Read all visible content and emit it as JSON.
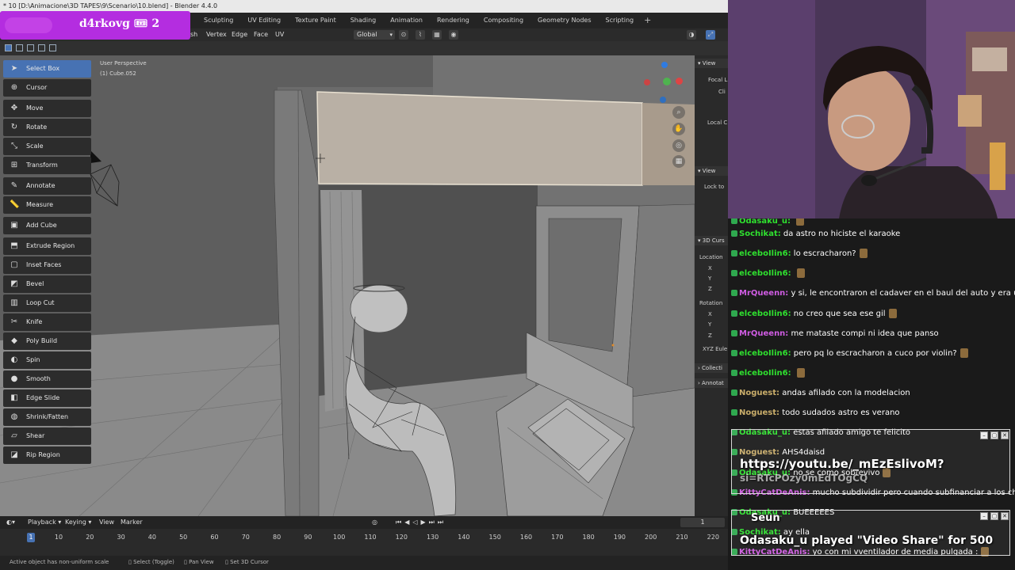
{
  "blender": {
    "title_bar": "* 10 [D:\\Animacione\\3D TAPES\\9\\Scenario\\10.blend] - Blender 4.4.0",
    "workspace_tabs": [
      "Sculpting",
      "UV Editing",
      "Texture Paint",
      "Shading",
      "Animation",
      "Rendering",
      "Compositing",
      "Geometry Nodes",
      "Scripting"
    ],
    "add_tab": "+",
    "edit_menus": [
      "sh",
      "Vertex",
      "Edge",
      "Face",
      "UV"
    ],
    "orientation": "Global",
    "viewport_info": {
      "line1": "User Perspective",
      "line2": "(1) Cube.052"
    },
    "tools": [
      {
        "label": "Select Box",
        "icon": "select-box-icon",
        "glyph": "➤",
        "active": true
      },
      {
        "label": "Cursor",
        "icon": "cursor-icon",
        "glyph": "⊕"
      },
      {
        "label": "Move",
        "icon": "move-icon",
        "glyph": "✥"
      },
      {
        "label": "Rotate",
        "icon": "rotate-icon",
        "glyph": "↻"
      },
      {
        "label": "Scale",
        "icon": "scale-icon",
        "glyph": "⤡"
      },
      {
        "label": "Transform",
        "icon": "transform-icon",
        "glyph": "⊞"
      },
      {
        "label": "Annotate",
        "icon": "annotate-icon",
        "glyph": "✎"
      },
      {
        "label": "Measure",
        "icon": "measure-icon",
        "glyph": "📏"
      },
      {
        "label": "Add Cube",
        "icon": "add-cube-icon",
        "glyph": "▣"
      },
      {
        "label": "Extrude Region",
        "icon": "extrude-region-icon",
        "glyph": "⬒"
      },
      {
        "label": "Inset Faces",
        "icon": "inset-faces-icon",
        "glyph": "▢"
      },
      {
        "label": "Bevel",
        "icon": "bevel-icon",
        "glyph": "◩"
      },
      {
        "label": "Loop Cut",
        "icon": "loop-cut-icon",
        "glyph": "▥"
      },
      {
        "label": "Knife",
        "icon": "knife-icon",
        "glyph": "✂"
      },
      {
        "label": "Poly Build",
        "icon": "poly-build-icon",
        "glyph": "◆"
      },
      {
        "label": "Spin",
        "icon": "spin-icon",
        "glyph": "◐"
      },
      {
        "label": "Smooth",
        "icon": "smooth-icon",
        "glyph": "●"
      },
      {
        "label": "Edge Slide",
        "icon": "edge-slide-icon",
        "glyph": "◧"
      },
      {
        "label": "Shrink/Fatten",
        "icon": "shrink-fatten-icon",
        "glyph": "◍"
      },
      {
        "label": "Shear",
        "icon": "shear-icon",
        "glyph": "▱"
      },
      {
        "label": "Rip Region",
        "icon": "rip-region-icon",
        "glyph": "◪"
      }
    ],
    "npanel": {
      "view": "View",
      "focal": "Focal L",
      "clip": "Cli",
      "local": "Local C",
      "view2": "View",
      "lock": "Lock to",
      "cursor3d": "3D Curs",
      "location": "Location",
      "x": "X",
      "y": "Y",
      "z": "Z",
      "rotation": "Rotation",
      "rx": "X",
      "ry": "Y",
      "rz": "Z",
      "euler": "XYZ Eule",
      "collection": "Collecti",
      "annotations": "Annotat"
    },
    "timeline": {
      "menus": [
        "Playback",
        "Keying",
        "View",
        "Marker"
      ],
      "current_frame_box": "1",
      "current_frame_marker": "1",
      "ticks": [
        "10",
        "20",
        "30",
        "40",
        "50",
        "60",
        "70",
        "80",
        "90",
        "100",
        "110",
        "120",
        "130",
        "140",
        "150",
        "160",
        "170",
        "180",
        "190",
        "200",
        "210",
        "220"
      ]
    },
    "status": {
      "left": "Active object has non-uniform scale",
      "select": "Select (Toggle)",
      "pan": "Pan View",
      "cursor": "Set 3D Cursor"
    }
  },
  "overlay": {
    "channel": "d4rkovg 🎟 2"
  },
  "chat": {
    "messages": [
      {
        "user": "Odasaku_u:",
        "text": "",
        "color": "#2fe02f",
        "emote": true
      },
      {
        "user": "Sochikat:",
        "text": "da astro no hiciste el karaoke",
        "color": "#2fe02f"
      },
      {
        "user": "elceboIlin6:",
        "text": "lo escracharon?",
        "color": "#2fe02f",
        "emote": true
      },
      {
        "user": "elceboIlin6:",
        "text": "",
        "color": "#2fe02f",
        "emote": true
      },
      {
        "user": "MrQueenn:",
        "text": "y si, le encontraron el cadaver en el baul del auto y era una menor",
        "color": "#d05ce3"
      },
      {
        "user": "elceboIlin6:",
        "text": "no creo que sea ese gil",
        "color": "#2fe02f",
        "emote": true
      },
      {
        "user": "MrQueenn:",
        "text": "me mataste compi ni idea que panso",
        "color": "#d05ce3"
      },
      {
        "user": "elceboIlin6:",
        "text": "pero pq lo escracharon a cuco por violin?",
        "color": "#2fe02f",
        "emote": true
      },
      {
        "user": "elceboIlin6:",
        "text": "",
        "color": "#2fe02f",
        "emote": true
      },
      {
        "user": "Noguest:",
        "text": "andas afilado con la modelacion",
        "color": "#c9ad6a"
      },
      {
        "user": "Noguest:",
        "text": "todo sudados astro es verano",
        "color": "#c9ad6a"
      },
      {
        "user": "Odasaku_u:",
        "text": "estas afilado amigo te felicito",
        "color": "#2fe02f"
      },
      {
        "user": "Noguest:",
        "text": "AHS4daisd",
        "color": "#c9ad6a"
      },
      {
        "user": "Odasaku_u:",
        "text": "no se como sobrevivo",
        "color": "#2fe02f",
        "emote": true
      },
      {
        "user": "KittyCatDeAnis:",
        "text": "mucho subdividir pero cuando subfinanciar a los chatters bro",
        "color": "#d05ce3",
        "emote": true
      },
      {
        "user": "Odasaku_u:",
        "text": "BUEEEEES",
        "color": "#2fe02f"
      },
      {
        "user": "Sochikat:",
        "text": "ay ella",
        "color": "#2fe02f"
      },
      {
        "user": "KittyCatDeAnis:",
        "text": "yo con mi vventilador de media pulgada :",
        "color": "#d05ce3",
        "emote": true
      }
    ],
    "popup1": {
      "line1": "https://youtu.be/_mEzEslivoM?",
      "line2": "si=RTcPOzy0mEdTOgCQ"
    },
    "popup2": {
      "line1": "Seun",
      "line2": "Odasaku_u played \"Video Share\" for 500"
    }
  }
}
